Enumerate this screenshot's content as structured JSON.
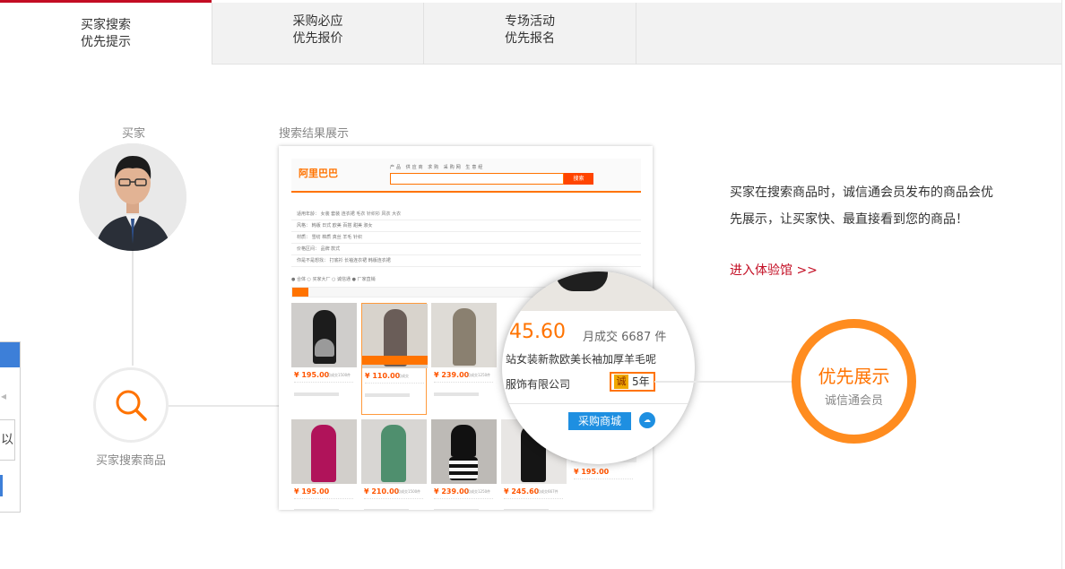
{
  "tabs": [
    {
      "line1": "买家搜索",
      "line2": "优先提示",
      "active": true
    },
    {
      "line1": "采购必应",
      "line2": "优先报价",
      "active": false
    },
    {
      "line1": "专场活动",
      "line2": "优先报名",
      "active": false
    }
  ],
  "float_panel": {
    "glyph": "以"
  },
  "flow": {
    "buyer_label": "买家",
    "search_label": "买家搜索商品",
    "result_label": "搜索结果展示"
  },
  "screenshot": {
    "logo": "阿里巴巴",
    "logo_sub": "1688.com",
    "search_button": "搜索",
    "mini_tabs": "产品 供应商 求购 采购网 生意经",
    "filter_rows": [
      "适用年龄：  女装  套装  连衣裙  毛衣  针织衫  风衣  大衣",
      "风格：  韩版  日式  欧美  百搭  甜美  淑女",
      "材质：  雪纺  棉质  真丝  羊毛  针织",
      "价格区间：  品牌  款式",
      "你是不是想找：  打底衫  长袖连衣裙  韩版连衣裙"
    ],
    "option_bar": "● 合体   ○ 买家大厂   ○ 诚信通   ● 厂家直销",
    "products": [
      {
        "price": "¥ 195.00",
        "meta": "月成交1500件"
      },
      {
        "price": "¥ 110.00",
        "meta": "月成交"
      },
      {
        "price": "¥ 239.00",
        "meta": "月成交1250件"
      },
      {
        "price": "¥ 195.00",
        "meta": ""
      },
      {
        "price": "¥ 210.00",
        "meta": "月成交1500件"
      },
      {
        "price": "¥ 239.00",
        "meta": "月成交1250件"
      },
      {
        "price": "¥ 245.60",
        "meta": "月成交667件"
      },
      {
        "price": "¥ 195.00",
        "meta": ""
      }
    ]
  },
  "magnifier": {
    "price": "45.60",
    "sold": "月成交 6687 件",
    "title": "站女装新款欧美长袖加厚羊毛呢",
    "company": "服饰有限公司",
    "cheng_glyph": "诚",
    "years": "5年",
    "mall_button": "采购商城"
  },
  "result": {
    "title": "优先展示",
    "subtitle": "诚信通会员"
  },
  "description": "买家在搜索商品时，诚信通会员发布的商品会优先展示，让买家快、最直接看到您的商品！",
  "enter_link": "进入体验馆 >>",
  "colors": {
    "accent": "#ff8c1f",
    "brand_red": "#c30d23",
    "blue": "#1e8fe1"
  }
}
